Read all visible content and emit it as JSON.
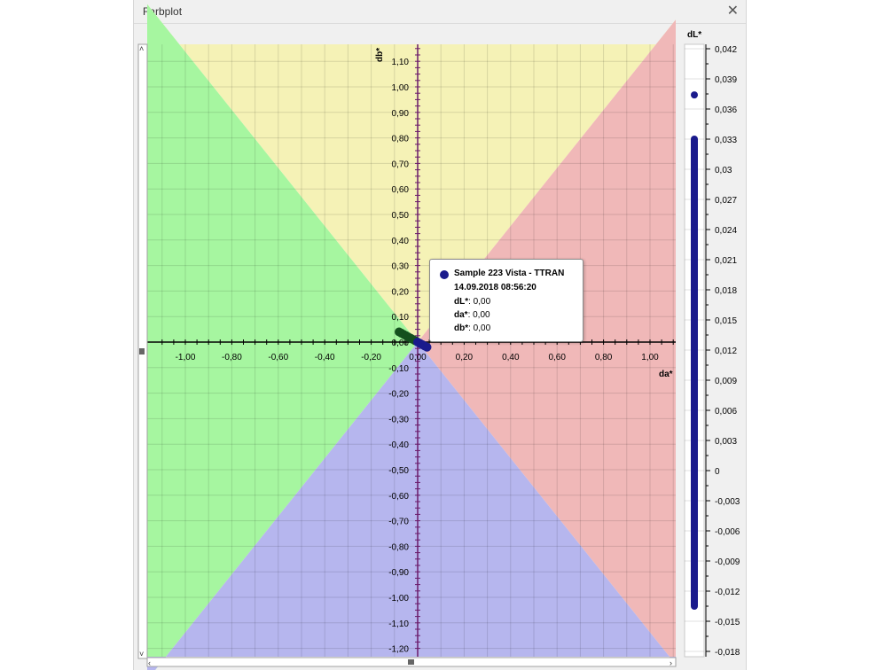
{
  "window": {
    "title": "Farbplot",
    "close_icon": "close-icon"
  },
  "colors": {
    "yellow_region": "#f5f2b6",
    "green_region": "#a6f6a0",
    "red_region": "#f0b8b8",
    "blue_region": "#b6b6ee",
    "axis": "#000000",
    "center_line": "#6a1a6a",
    "point_green": "#14501e",
    "point_blue": "#1a1a8c"
  },
  "tooltip": {
    "sample": "Sample 223 Vista - TTRAN",
    "datetime": "14.09.2018 08:56:20",
    "rows": [
      {
        "label": "dL*",
        "value": ": 0,00"
      },
      {
        "label": "da*",
        "value": ": 0,00"
      },
      {
        "label": "db*",
        "value": ": 0,00"
      }
    ]
  },
  "chart_data": [
    {
      "type": "scatter",
      "xlabel": "da*",
      "ylabel": "db*",
      "xlim": [
        -1.15,
        1.1
      ],
      "ylim": [
        -1.22,
        1.16
      ],
      "x_tick_labels": [
        "-1,00",
        "-0,80",
        "-0,60",
        "-0,40",
        "-0,20",
        "0,00",
        "0,20",
        "0,40",
        "0,60",
        "0,80",
        "1,00"
      ],
      "x_tick_values": [
        -1.0,
        -0.8,
        -0.6,
        -0.4,
        -0.2,
        0.0,
        0.2,
        0.4,
        0.6,
        0.8,
        1.0
      ],
      "y_tick_labels": [
        "1,10",
        "1,00",
        "0,90",
        "0,80",
        "0,70",
        "0,60",
        "0,50",
        "0,40",
        "0,30",
        "0,20",
        "0,10",
        "0,00",
        "-0,10",
        "-0,20",
        "-0,30",
        "-0,40",
        "-0,50",
        "-0,60",
        "-0,70",
        "-0,80",
        "-0,90",
        "-1,00",
        "-1,10",
        "-1,20"
      ],
      "y_tick_values": [
        1.1,
        1.0,
        0.9,
        0.8,
        0.7,
        0.6,
        0.5,
        0.4,
        0.3,
        0.2,
        0.1,
        0.0,
        -0.1,
        -0.2,
        -0.3,
        -0.4,
        -0.5,
        -0.6,
        -0.7,
        -0.8,
        -0.9,
        -1.0,
        -1.1,
        -1.2
      ],
      "grid": true,
      "series": [
        {
          "color": "#14501e",
          "points": [
            [
              -0.08,
              0.04
            ],
            [
              -0.07,
              0.035
            ],
            [
              -0.06,
              0.03
            ],
            [
              -0.05,
              0.025
            ],
            [
              -0.04,
              0.02
            ],
            [
              -0.03,
              0.015
            ],
            [
              -0.02,
              0.01
            ],
            [
              -0.01,
              0.005
            ]
          ]
        },
        {
          "color": "#1a1a8c",
          "points": [
            [
              0.0,
              0.0
            ],
            [
              0.01,
              -0.005
            ],
            [
              0.02,
              -0.01
            ],
            [
              0.03,
              -0.015
            ],
            [
              0.04,
              -0.02
            ]
          ]
        }
      ]
    },
    {
      "type": "scatter",
      "ylabel": "dL*",
      "ylim": [
        -0.0185,
        0.0435
      ],
      "y_tick_labels": [
        "0,042",
        "0,039",
        "0,036",
        "0,033",
        "0,03",
        "0,027",
        "0,024",
        "0,021",
        "0,018",
        "0,015",
        "0,012",
        "0,009",
        "0,006",
        "0,003",
        "0",
        "-0,003",
        "-0,006",
        "-0,009",
        "-0,012",
        "-0,015",
        "-0,018"
      ],
      "y_tick_values": [
        0.042,
        0.039,
        0.036,
        0.033,
        0.03,
        0.027,
        0.024,
        0.021,
        0.018,
        0.015,
        0.012,
        0.009,
        0.006,
        0.003,
        0.0,
        -0.003,
        -0.006,
        -0.009,
        -0.012,
        -0.015,
        -0.018
      ],
      "series": [
        {
          "color": "#1a1a8c",
          "values": [
            0.0374,
            0.033,
            0.032,
            0.0312,
            0.0305,
            0.0298,
            0.029,
            0.0282,
            0.0275,
            0.0268,
            0.026,
            0.0252,
            0.0245,
            0.0238,
            0.023,
            0.021,
            0.018,
            0.015,
            0.012,
            0.009,
            0.006,
            0.003,
            0.0,
            -0.003,
            -0.006,
            -0.008,
            -0.009,
            -0.01,
            -0.0105,
            -0.011,
            -0.012,
            -0.0125,
            -0.013,
            -0.0135
          ]
        }
      ]
    }
  ]
}
